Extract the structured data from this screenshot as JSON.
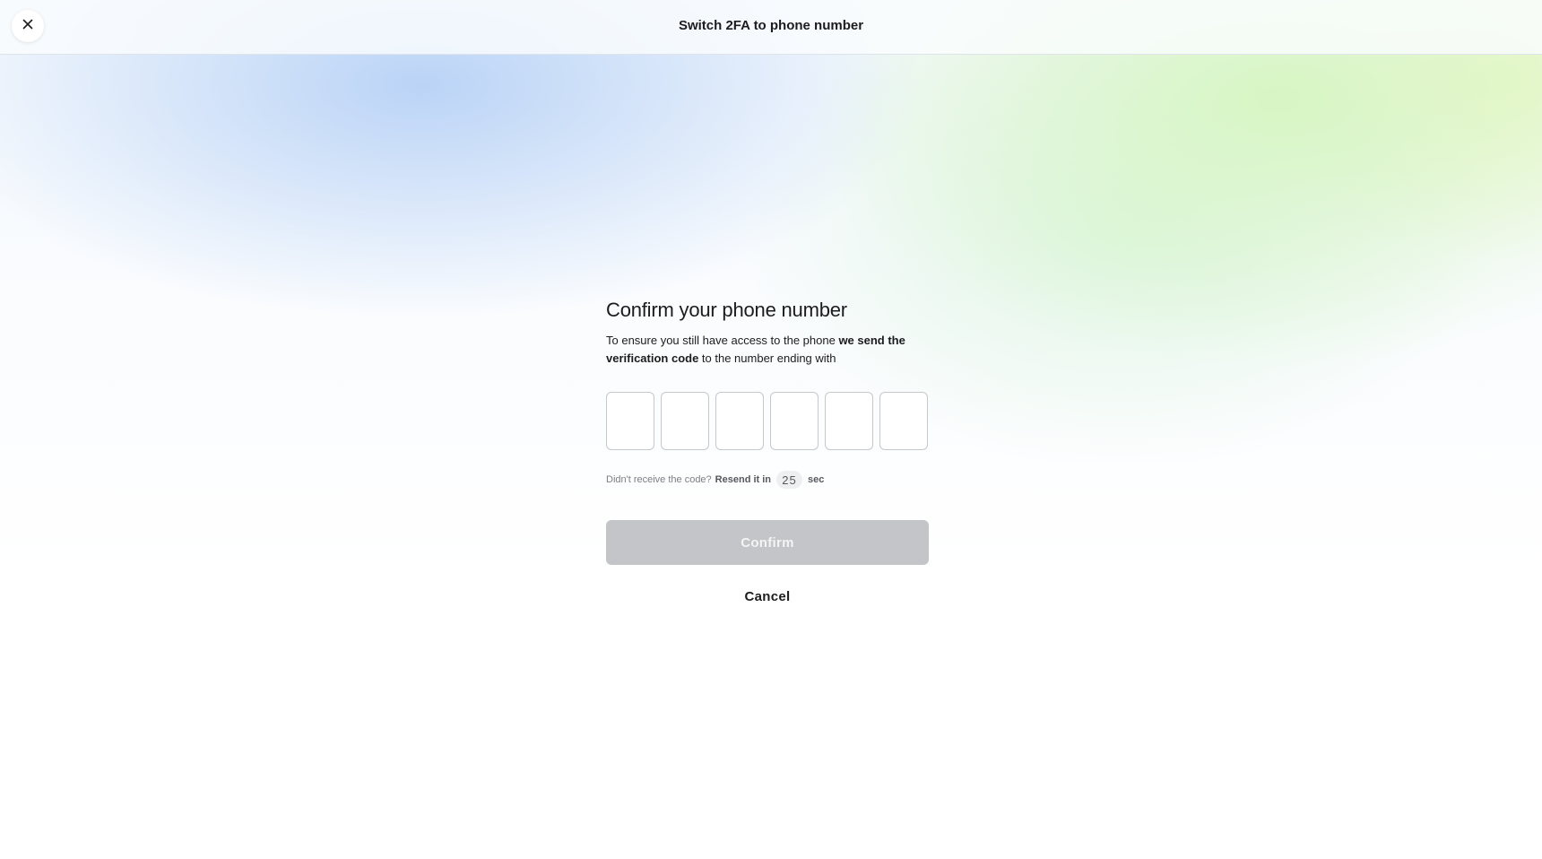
{
  "header": {
    "title": "Switch 2FA to phone number",
    "close_icon": "close-icon"
  },
  "main": {
    "heading": "Confirm your phone number",
    "description": {
      "part1": "To ensure you still have access to the phone ",
      "bold": "we send the verification code",
      "part2": " to the number ending with"
    },
    "code_digits": [
      "",
      "",
      "",
      "",
      "",
      ""
    ],
    "resend": {
      "prompt": "Didn't receive the code?",
      "label": "Resend it in",
      "seconds": "25",
      "unit": "sec"
    },
    "confirm_label": "Confirm",
    "cancel_label": "Cancel"
  },
  "colors": {
    "confirm_disabled_bg": "#c4c5c8",
    "text_primary": "#1c1c1e",
    "text_muted": "#7b7e84"
  }
}
